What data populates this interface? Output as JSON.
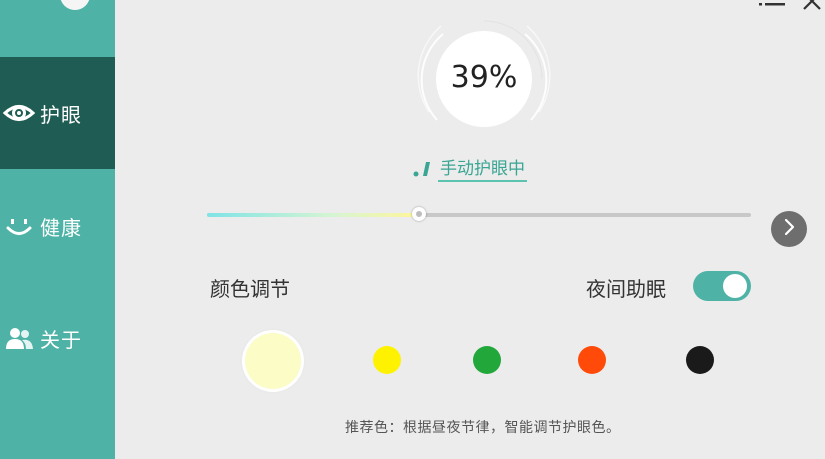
{
  "colors": {
    "sidebar": "#4eb3a6",
    "sidebar_active": "#1f5d54",
    "accent": "#4eb3a6",
    "background": "#ececec"
  },
  "sidebar": {
    "items": [
      {
        "label": "护眼",
        "icon": "eye-icon",
        "active": true
      },
      {
        "label": "健康",
        "icon": "smile-icon",
        "active": false
      },
      {
        "label": "关于",
        "icon": "users-icon",
        "active": false
      }
    ]
  },
  "window": {
    "menu_icon": "menu-icon",
    "close_icon": "close-icon"
  },
  "gauge": {
    "value_text": "39%",
    "value": 39
  },
  "mode": {
    "label": "手动护眼中"
  },
  "slider": {
    "value": 0.39
  },
  "next_icon": "chevron-right-icon",
  "color_adjust": {
    "label": "颜色调节"
  },
  "night_sleep": {
    "label": "夜间助眠",
    "enabled": true
  },
  "swatches": [
    {
      "color": "#fbfcc6",
      "selected": true
    },
    {
      "color": "#fff200",
      "selected": false
    },
    {
      "color": "#22a83a",
      "selected": false
    },
    {
      "color": "#ff4a0a",
      "selected": false
    },
    {
      "color": "#1a1a1a",
      "selected": false
    }
  ],
  "hint": "推荐色：根据昼夜节律，智能调节护眼色。"
}
